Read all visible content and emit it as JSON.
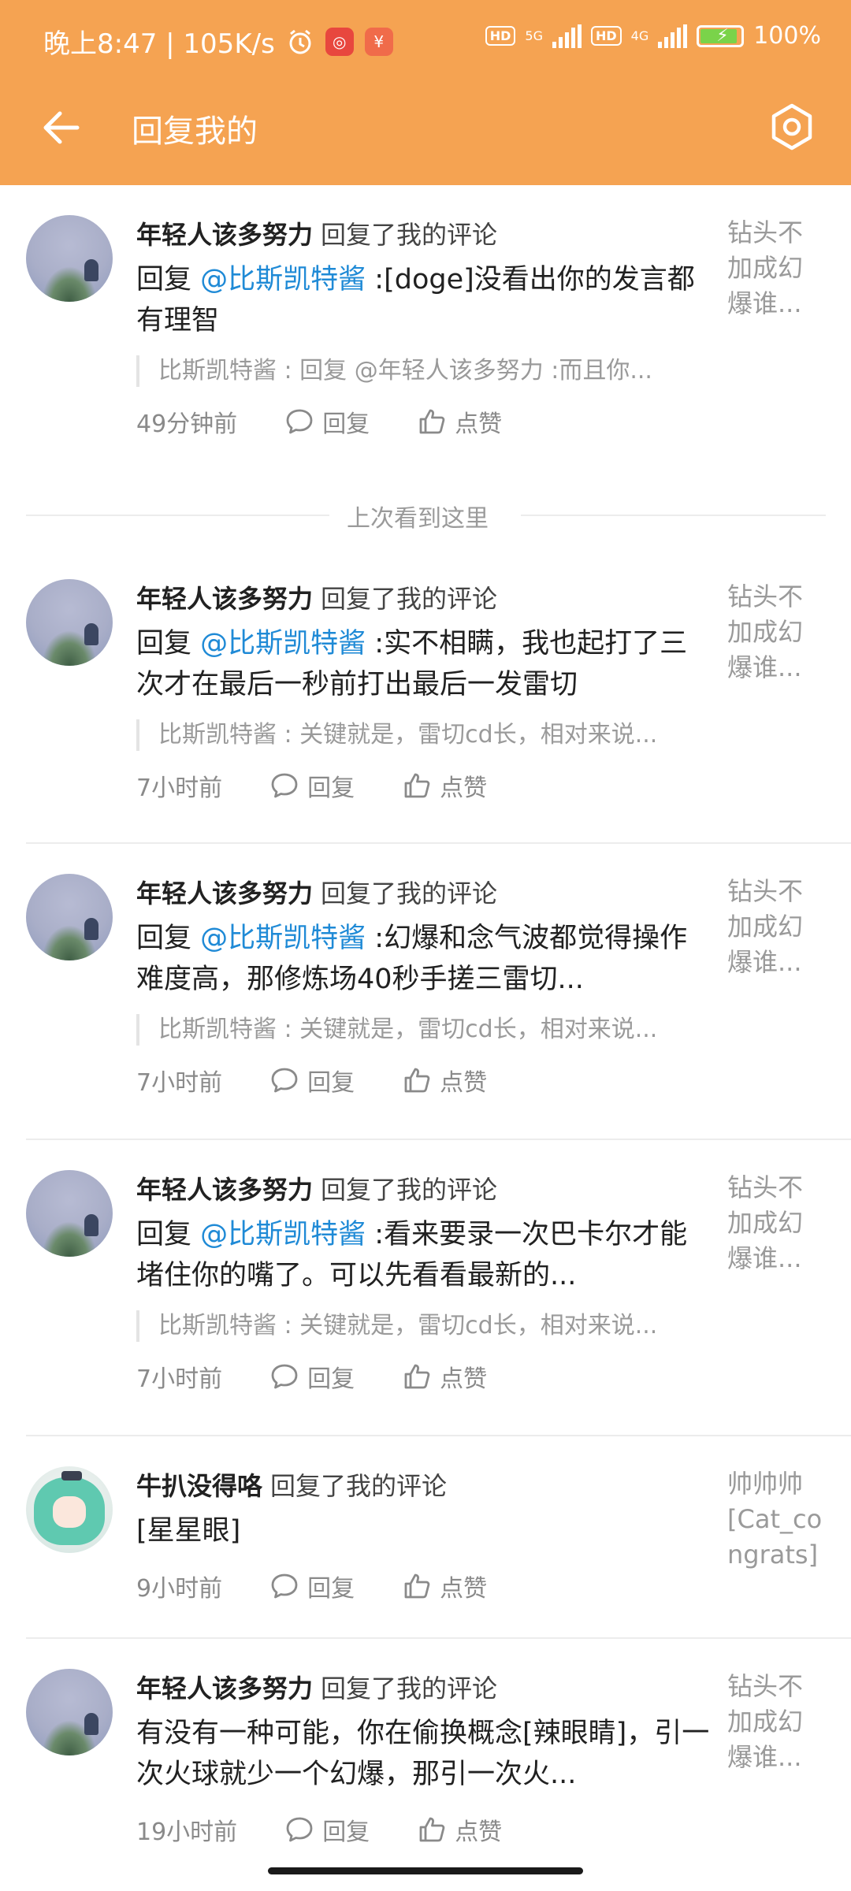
{
  "status_bar": {
    "time_speed": "晚上8:47 | 105K/s",
    "badge_app1": "◎",
    "badge_app2": "¥",
    "hd1": "HD",
    "net1": "5G",
    "hd2": "HD",
    "net2": "4G",
    "battery": "100%"
  },
  "app_bar": {
    "title": "回复我的",
    "back_icon": "arrow-left-icon",
    "settings_icon": "hexagon-gear-icon",
    "color": "#f5a352"
  },
  "last_seen_label": "上次看到这里",
  "actions": {
    "reply": "回复",
    "like": "点赞"
  },
  "items": [
    {
      "name": "年轻人该多努力",
      "action": "回复了我的评论",
      "reply_prefix": "回复 ",
      "mention": "@比斯凯特酱",
      "text": " :[doge]没看出你的发言都有理智",
      "quote": "比斯凯特酱 : 回复 @年轻人该多努力 :而且你...",
      "time": "49分钟前",
      "side": "钻头不加成幻爆谁..."
    },
    {
      "name": "年轻人该多努力",
      "action": "回复了我的评论",
      "reply_prefix": "回复 ",
      "mention": "@比斯凯特酱",
      "text": " :实不相瞒，我也起打了三次才在最后一秒前打出最后一发雷切",
      "quote": "比斯凯特酱 : 关键就是，雷切cd长，相对来说...",
      "time": "7小时前",
      "side": "钻头不加成幻爆谁..."
    },
    {
      "name": "年轻人该多努力",
      "action": "回复了我的评论",
      "reply_prefix": "回复 ",
      "mention": "@比斯凯特酱",
      "text": " :幻爆和念气波都觉得操作难度高，那修炼场40秒手搓三雷切...",
      "quote": "比斯凯特酱 : 关键就是，雷切cd长，相对来说...",
      "time": "7小时前",
      "side": "钻头不加成幻爆谁..."
    },
    {
      "name": "年轻人该多努力",
      "action": "回复了我的评论",
      "reply_prefix": "回复 ",
      "mention": "@比斯凯特酱",
      "text": " :看来要录一次巴卡尔才能堵住你的嘴了。可以先看看最新的...",
      "quote": "比斯凯特酱 : 关键就是，雷切cd长，相对来说...",
      "time": "7小时前",
      "side": "钻头不加成幻爆谁..."
    },
    {
      "name": "牛扒没得咯",
      "action": "回复了我的评论",
      "reply_prefix": "",
      "mention": "",
      "text": "[星星眼]",
      "quote": "",
      "time": "9小时前",
      "side": "帅帅帅 [Cat_congrats]"
    },
    {
      "name": "年轻人该多努力",
      "action": "回复了我的评论",
      "reply_prefix": "",
      "mention": "",
      "text": "有没有一种可能，你在偷换概念[辣眼睛]，引一次火球就少一个幻爆，那引一次火...",
      "quote": "",
      "time": "19小时前",
      "side": "钻头不加成幻爆谁..."
    }
  ]
}
